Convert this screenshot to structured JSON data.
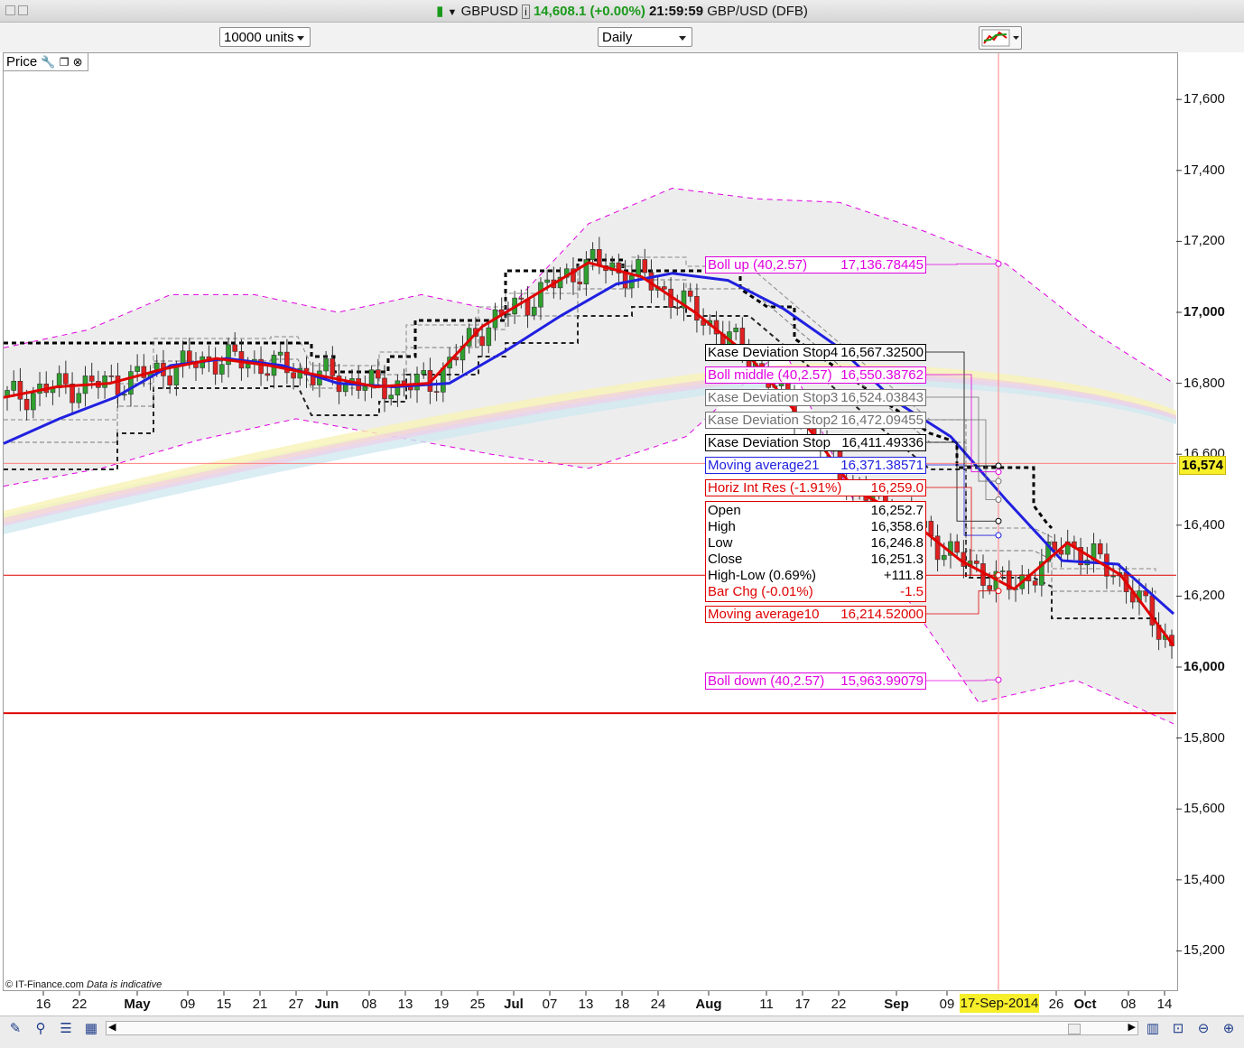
{
  "window": {
    "symbol": "GBPUSD",
    "price_text": "14,608.1",
    "change_text": "(+0.00%)",
    "time": "21:59:59",
    "instrument": "GBP/USD (DFB)"
  },
  "toolbar": {
    "units_value": "10000 units",
    "period_value": "Daily"
  },
  "price_tab_label": "Price",
  "current_price_badge": "16,574",
  "highlight_date": "17-Sep-2014",
  "copyright": "© IT-Finance.com",
  "disclaimer": "Data is indicative",
  "y_axis": [
    {
      "text": "17,600",
      "value": 17600,
      "bold": false
    },
    {
      "text": "17,400",
      "value": 17400,
      "bold": false
    },
    {
      "text": "17,200",
      "value": 17200,
      "bold": false
    },
    {
      "text": "17,000",
      "value": 17000,
      "bold": true
    },
    {
      "text": "16,800",
      "value": 16800,
      "bold": false
    },
    {
      "text": "16,600",
      "value": 16600,
      "bold": false
    },
    {
      "text": "16,400",
      "value": 16400,
      "bold": false
    },
    {
      "text": "16,200",
      "value": 16200,
      "bold": false
    },
    {
      "text": "16,000",
      "value": 16000,
      "bold": true
    },
    {
      "text": "15,800",
      "value": 15800,
      "bold": false
    },
    {
      "text": "15,600",
      "value": 15600,
      "bold": false
    },
    {
      "text": "15,400",
      "value": 15400,
      "bold": false
    },
    {
      "text": "15,200",
      "value": 15200,
      "bold": false
    }
  ],
  "x_axis": [
    {
      "text": "16",
      "bold": false
    },
    {
      "text": "22",
      "bold": false
    },
    {
      "text": "May",
      "bold": true
    },
    {
      "text": "09",
      "bold": false
    },
    {
      "text": "15",
      "bold": false
    },
    {
      "text": "21",
      "bold": false
    },
    {
      "text": "27",
      "bold": false
    },
    {
      "text": "Jun",
      "bold": true
    },
    {
      "text": "08",
      "bold": false
    },
    {
      "text": "13",
      "bold": false
    },
    {
      "text": "19",
      "bold": false
    },
    {
      "text": "25",
      "bold": false
    },
    {
      "text": "Jul",
      "bold": true
    },
    {
      "text": "07",
      "bold": false
    },
    {
      "text": "13",
      "bold": false
    },
    {
      "text": "18",
      "bold": false
    },
    {
      "text": "24",
      "bold": false
    },
    {
      "text": "Aug",
      "bold": true
    },
    {
      "text": "11",
      "bold": false
    },
    {
      "text": "17",
      "bold": false
    },
    {
      "text": "22",
      "bold": false
    },
    {
      "text": "Sep",
      "bold": true
    },
    {
      "text": "09",
      "bold": false
    },
    {
      "text": "26",
      "bold": false
    },
    {
      "text": "Oct",
      "bold": true
    },
    {
      "text": "08",
      "bold": false
    },
    {
      "text": "14",
      "bold": false
    }
  ],
  "indicators": [
    {
      "label": "Boll up (40,2.57)",
      "value": "17,136.78445",
      "color": "#e000e0",
      "price": 17136.78
    },
    {
      "label": "Kase Deviation Stop4",
      "value": "16,567.32500",
      "color": "#000000",
      "price": 16567.33
    },
    {
      "label": "Boll middle (40,2.57)",
      "value": "16,550.38762",
      "color": "#e000e0",
      "price": 16550.39
    },
    {
      "label": "Kase Deviation Stop3",
      "value": "16,524.03843",
      "color": "#707070",
      "price": 16524.04
    },
    {
      "label": "Kase Deviation Stop2",
      "value": "16,472.09455",
      "color": "#707070",
      "price": 16472.09
    },
    {
      "label": "Kase Deviation Stop",
      "value": "16,411.49336",
      "color": "#000000",
      "price": 16411.49
    },
    {
      "label": "Moving average21",
      "value": "16,371.38571",
      "color": "#2020e0",
      "price": 16371.39
    },
    {
      "label": "Horiz Int Res (-1.91%)",
      "value": "16,259.0",
      "color": "#e00000",
      "price": 16259.0
    },
    {
      "label": "Moving average10",
      "value": "16,214.52000",
      "color": "#e00000",
      "price": 16214.52
    },
    {
      "label": "Boll down (40,2.57)",
      "value": "15,963.99079",
      "color": "#e000e0",
      "price": 15963.99
    }
  ],
  "ohlc": [
    {
      "label": "Open",
      "value": "16,252.7",
      "color": "#000000"
    },
    {
      "label": "High",
      "value": "16,358.6",
      "color": "#000000"
    },
    {
      "label": "Low",
      "value": "16,246.8",
      "color": "#000000"
    },
    {
      "label": "Close",
      "value": "16,251.3",
      "color": "#000000"
    },
    {
      "label": "High-Low (0.69%)",
      "value": "+111.8",
      "color": "#000000"
    },
    {
      "label": "Bar Chg (-0.01%)",
      "value": "-1.5",
      "color": "#e00000"
    }
  ],
  "chart_data": {
    "type": "candlestick",
    "title": "GBPUSD",
    "period": "Daily",
    "ylim": [
      15100,
      17750
    ],
    "horizontal_lines": [
      {
        "price": 16574,
        "color": "#ff8080"
      },
      {
        "price": 16259,
        "color": "#e00000"
      },
      {
        "price": 15870,
        "color": "#e00000"
      }
    ],
    "series": [
      {
        "name": "Moving average10",
        "color": "#e00000",
        "values": [
          16760,
          16790,
          16800,
          16840,
          16870,
          16850,
          16820,
          16790,
          16800,
          16960,
          17050,
          17140,
          17100,
          17000,
          16880,
          16700,
          16500,
          16420,
          16300,
          16220,
          16350,
          16260,
          16060
        ]
      },
      {
        "name": "Moving average21",
        "color": "#2020e0",
        "values": [
          16630,
          16700,
          16760,
          16850,
          16870,
          16850,
          16800,
          16790,
          16800,
          16890,
          16990,
          17080,
          17110,
          17090,
          17010,
          16900,
          16750,
          16650,
          16470,
          16300,
          16290,
          16150
        ]
      },
      {
        "name": "Boll up (40,2.57)",
        "color": "#e000e0",
        "values": [
          16900,
          16950,
          17050,
          17050,
          17000,
          17050,
          17000,
          17250,
          17350,
          17320,
          17310,
          17230,
          17136,
          16950,
          16800
        ]
      },
      {
        "name": "Boll down (40,2.57)",
        "color": "#e000e0",
        "values": [
          16510,
          16560,
          16640,
          16700,
          16650,
          16600,
          16560,
          16650,
          16900,
          16300,
          15900,
          15963,
          15840
        ]
      }
    ]
  }
}
